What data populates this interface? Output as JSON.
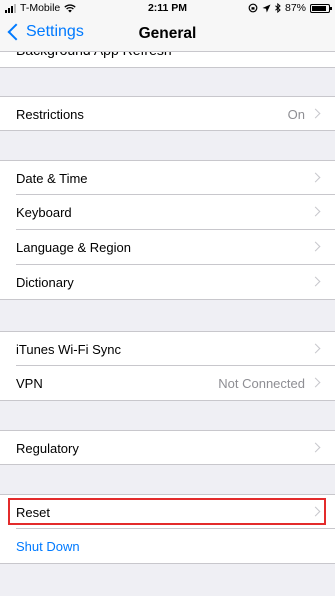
{
  "status": {
    "carrier": "T-Mobile",
    "time": "2:11 PM",
    "battery_percent": "87%",
    "battery_level": 0.87
  },
  "nav": {
    "back_label": "Settings",
    "title": "General"
  },
  "clipped_row": {
    "label": "Background App Refresh"
  },
  "rows": {
    "restrictions": {
      "label": "Restrictions",
      "value": "On"
    },
    "date_time": {
      "label": "Date & Time"
    },
    "keyboard": {
      "label": "Keyboard"
    },
    "language_region": {
      "label": "Language & Region"
    },
    "dictionary": {
      "label": "Dictionary"
    },
    "itunes_sync": {
      "label": "iTunes Wi-Fi Sync"
    },
    "vpn": {
      "label": "VPN",
      "value": "Not Connected"
    },
    "regulatory": {
      "label": "Regulatory"
    },
    "reset": {
      "label": "Reset"
    },
    "shut_down": {
      "label": "Shut Down"
    }
  },
  "colors": {
    "accent": "#007aff",
    "highlight": "#e32b2b",
    "background": "#efeff4"
  }
}
